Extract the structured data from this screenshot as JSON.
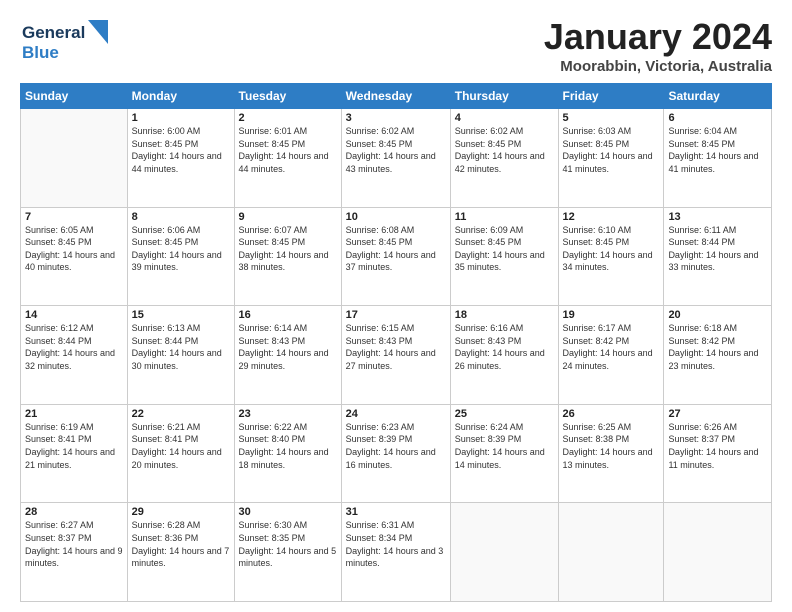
{
  "header": {
    "logo_line1": "General",
    "logo_line2": "Blue",
    "month_title": "January 2024",
    "location": "Moorabbin, Victoria, Australia"
  },
  "weekdays": [
    "Sunday",
    "Monday",
    "Tuesday",
    "Wednesday",
    "Thursday",
    "Friday",
    "Saturday"
  ],
  "weeks": [
    [
      {
        "day": "",
        "sunrise": "",
        "sunset": "",
        "daylight": ""
      },
      {
        "day": "1",
        "sunrise": "Sunrise: 6:00 AM",
        "sunset": "Sunset: 8:45 PM",
        "daylight": "Daylight: 14 hours and 44 minutes."
      },
      {
        "day": "2",
        "sunrise": "Sunrise: 6:01 AM",
        "sunset": "Sunset: 8:45 PM",
        "daylight": "Daylight: 14 hours and 44 minutes."
      },
      {
        "day": "3",
        "sunrise": "Sunrise: 6:02 AM",
        "sunset": "Sunset: 8:45 PM",
        "daylight": "Daylight: 14 hours and 43 minutes."
      },
      {
        "day": "4",
        "sunrise": "Sunrise: 6:02 AM",
        "sunset": "Sunset: 8:45 PM",
        "daylight": "Daylight: 14 hours and 42 minutes."
      },
      {
        "day": "5",
        "sunrise": "Sunrise: 6:03 AM",
        "sunset": "Sunset: 8:45 PM",
        "daylight": "Daylight: 14 hours and 41 minutes."
      },
      {
        "day": "6",
        "sunrise": "Sunrise: 6:04 AM",
        "sunset": "Sunset: 8:45 PM",
        "daylight": "Daylight: 14 hours and 41 minutes."
      }
    ],
    [
      {
        "day": "7",
        "sunrise": "Sunrise: 6:05 AM",
        "sunset": "Sunset: 8:45 PM",
        "daylight": "Daylight: 14 hours and 40 minutes."
      },
      {
        "day": "8",
        "sunrise": "Sunrise: 6:06 AM",
        "sunset": "Sunset: 8:45 PM",
        "daylight": "Daylight: 14 hours and 39 minutes."
      },
      {
        "day": "9",
        "sunrise": "Sunrise: 6:07 AM",
        "sunset": "Sunset: 8:45 PM",
        "daylight": "Daylight: 14 hours and 38 minutes."
      },
      {
        "day": "10",
        "sunrise": "Sunrise: 6:08 AM",
        "sunset": "Sunset: 8:45 PM",
        "daylight": "Daylight: 14 hours and 37 minutes."
      },
      {
        "day": "11",
        "sunrise": "Sunrise: 6:09 AM",
        "sunset": "Sunset: 8:45 PM",
        "daylight": "Daylight: 14 hours and 35 minutes."
      },
      {
        "day": "12",
        "sunrise": "Sunrise: 6:10 AM",
        "sunset": "Sunset: 8:45 PM",
        "daylight": "Daylight: 14 hours and 34 minutes."
      },
      {
        "day": "13",
        "sunrise": "Sunrise: 6:11 AM",
        "sunset": "Sunset: 8:44 PM",
        "daylight": "Daylight: 14 hours and 33 minutes."
      }
    ],
    [
      {
        "day": "14",
        "sunrise": "Sunrise: 6:12 AM",
        "sunset": "Sunset: 8:44 PM",
        "daylight": "Daylight: 14 hours and 32 minutes."
      },
      {
        "day": "15",
        "sunrise": "Sunrise: 6:13 AM",
        "sunset": "Sunset: 8:44 PM",
        "daylight": "Daylight: 14 hours and 30 minutes."
      },
      {
        "day": "16",
        "sunrise": "Sunrise: 6:14 AM",
        "sunset": "Sunset: 8:43 PM",
        "daylight": "Daylight: 14 hours and 29 minutes."
      },
      {
        "day": "17",
        "sunrise": "Sunrise: 6:15 AM",
        "sunset": "Sunset: 8:43 PM",
        "daylight": "Daylight: 14 hours and 27 minutes."
      },
      {
        "day": "18",
        "sunrise": "Sunrise: 6:16 AM",
        "sunset": "Sunset: 8:43 PM",
        "daylight": "Daylight: 14 hours and 26 minutes."
      },
      {
        "day": "19",
        "sunrise": "Sunrise: 6:17 AM",
        "sunset": "Sunset: 8:42 PM",
        "daylight": "Daylight: 14 hours and 24 minutes."
      },
      {
        "day": "20",
        "sunrise": "Sunrise: 6:18 AM",
        "sunset": "Sunset: 8:42 PM",
        "daylight": "Daylight: 14 hours and 23 minutes."
      }
    ],
    [
      {
        "day": "21",
        "sunrise": "Sunrise: 6:19 AM",
        "sunset": "Sunset: 8:41 PM",
        "daylight": "Daylight: 14 hours and 21 minutes."
      },
      {
        "day": "22",
        "sunrise": "Sunrise: 6:21 AM",
        "sunset": "Sunset: 8:41 PM",
        "daylight": "Daylight: 14 hours and 20 minutes."
      },
      {
        "day": "23",
        "sunrise": "Sunrise: 6:22 AM",
        "sunset": "Sunset: 8:40 PM",
        "daylight": "Daylight: 14 hours and 18 minutes."
      },
      {
        "day": "24",
        "sunrise": "Sunrise: 6:23 AM",
        "sunset": "Sunset: 8:39 PM",
        "daylight": "Daylight: 14 hours and 16 minutes."
      },
      {
        "day": "25",
        "sunrise": "Sunrise: 6:24 AM",
        "sunset": "Sunset: 8:39 PM",
        "daylight": "Daylight: 14 hours and 14 minutes."
      },
      {
        "day": "26",
        "sunrise": "Sunrise: 6:25 AM",
        "sunset": "Sunset: 8:38 PM",
        "daylight": "Daylight: 14 hours and 13 minutes."
      },
      {
        "day": "27",
        "sunrise": "Sunrise: 6:26 AM",
        "sunset": "Sunset: 8:37 PM",
        "daylight": "Daylight: 14 hours and 11 minutes."
      }
    ],
    [
      {
        "day": "28",
        "sunrise": "Sunrise: 6:27 AM",
        "sunset": "Sunset: 8:37 PM",
        "daylight": "Daylight: 14 hours and 9 minutes."
      },
      {
        "day": "29",
        "sunrise": "Sunrise: 6:28 AM",
        "sunset": "Sunset: 8:36 PM",
        "daylight": "Daylight: 14 hours and 7 minutes."
      },
      {
        "day": "30",
        "sunrise": "Sunrise: 6:30 AM",
        "sunset": "Sunset: 8:35 PM",
        "daylight": "Daylight: 14 hours and 5 minutes."
      },
      {
        "day": "31",
        "sunrise": "Sunrise: 6:31 AM",
        "sunset": "Sunset: 8:34 PM",
        "daylight": "Daylight: 14 hours and 3 minutes."
      },
      {
        "day": "",
        "sunrise": "",
        "sunset": "",
        "daylight": ""
      },
      {
        "day": "",
        "sunrise": "",
        "sunset": "",
        "daylight": ""
      },
      {
        "day": "",
        "sunrise": "",
        "sunset": "",
        "daylight": ""
      }
    ]
  ]
}
